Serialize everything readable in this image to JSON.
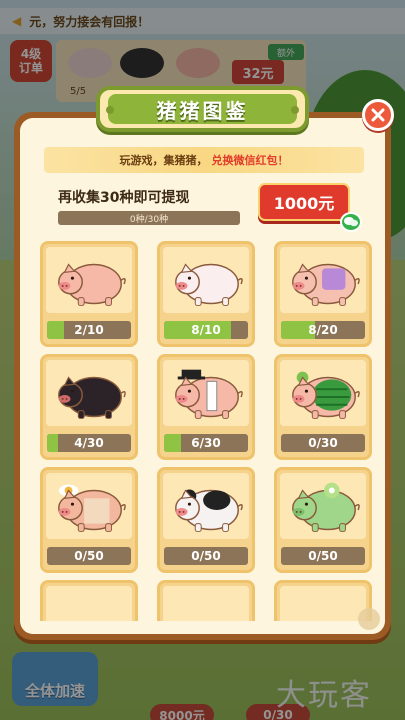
{
  "background": {
    "ticker": "元，努力接会有回报！",
    "order_level": "4级",
    "order_label": "订单",
    "order_count": "5/5",
    "order_money": "32元",
    "order_tag": "额外",
    "speed_button": "全体加速",
    "pill_left": "8000元",
    "pill_right": "0/30",
    "watermark": "大玩客"
  },
  "modal": {
    "title": "猪猪图鉴",
    "banner_prefix": "玩游戏，集猪猪，",
    "banner_highlight": "兑换微信红包！",
    "goal_text": "再收集30种即可提现",
    "goal_progress_label": "0种/30种",
    "goal_progress": 0,
    "cash_button": "1000元"
  },
  "colors": {
    "accent_green": "#8fb43a",
    "cash_red": "#e03a2c",
    "progress_fill": "#8fc344"
  },
  "pigs": [
    {
      "name": "pig-plain",
      "label": "2/10",
      "progress": 0.2
    },
    {
      "name": "pig-white",
      "label": "8/10",
      "progress": 0.8
    },
    {
      "name": "pig-overalls",
      "label": "8/20",
      "progress": 0.4
    },
    {
      "name": "pig-black",
      "label": "4/30",
      "progress": 0.1333
    },
    {
      "name": "pig-tophat",
      "label": "6/30",
      "progress": 0.2
    },
    {
      "name": "pig-watermelon",
      "label": "0/30",
      "progress": 0
    },
    {
      "name": "pig-egg",
      "label": "0/50",
      "progress": 0
    },
    {
      "name": "pig-panda",
      "label": "0/50",
      "progress": 0
    },
    {
      "name": "pig-green",
      "label": "0/50",
      "progress": 0
    }
  ]
}
